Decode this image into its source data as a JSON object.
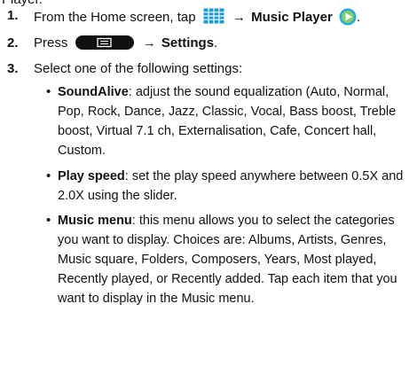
{
  "clip_text": "Player.",
  "steps": [
    {
      "num": "1.",
      "pre": "From the Home screen, tap",
      "arrow": "→",
      "target": "Music Player",
      "post": "."
    },
    {
      "num": "2.",
      "pre": "Press",
      "arrow": "→",
      "target": "Settings",
      "post": "."
    },
    {
      "num": "3.",
      "text": "Select one of the following settings:"
    }
  ],
  "bullets": [
    {
      "term": "SoundAlive",
      "lines": [
        ": adjust the sound equalization (Auto, Normal,",
        "Pop, Rock, Dance, Jazz, Classic, Vocal, Bass boost, Treble",
        "boost, Virtual 7.1 ch, Externalisation, Cafe, Concert hall,",
        "Custom."
      ]
    },
    {
      "term": "Play speed",
      "lines": [
        ": set the play speed anywhere between 0.5X and",
        "2.0X using the slider."
      ]
    },
    {
      "term": "Music menu",
      "lines": [
        ": this menu allows you to select the categories",
        "you want to display. Choices are: Albums, Artists, Genres,",
        "Music square, Folders, Composers, Years, Most played,",
        "Recently played, or Recently added. Tap each item that you",
        "want to display in the Music menu."
      ]
    }
  ],
  "colors": {
    "grid_icon": "#1a9bd7",
    "play_icon": "#29a8e0",
    "menu_key": "#111111"
  },
  "icons": [
    "apps-grid-icon",
    "music-player-icon",
    "menu-key-icon"
  ]
}
